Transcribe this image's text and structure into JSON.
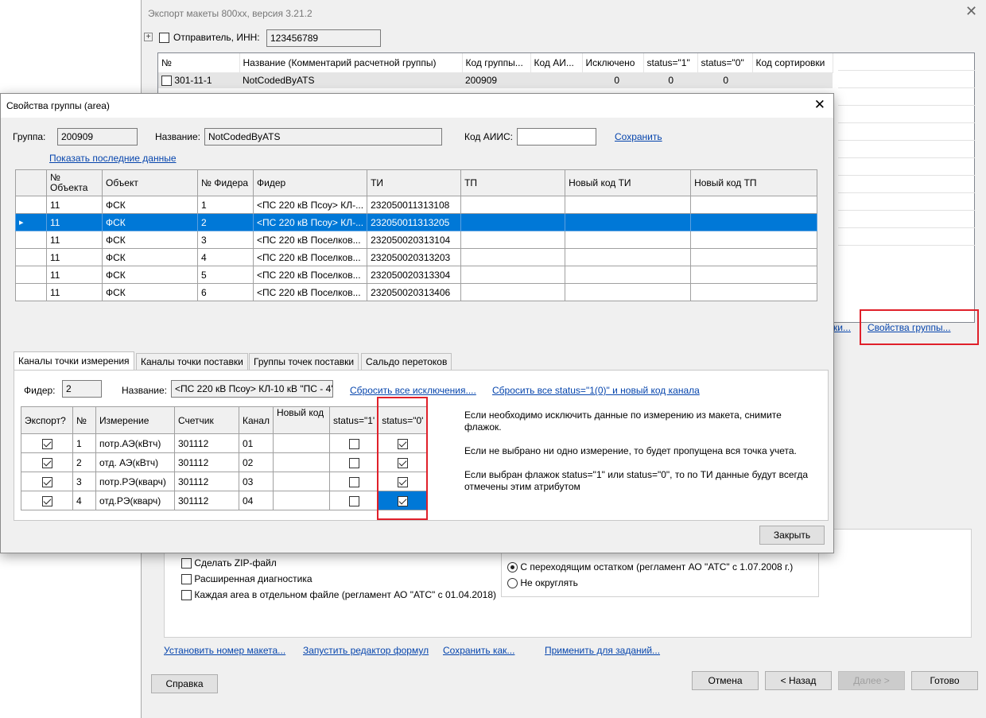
{
  "bg_window": {
    "title": "Экспорт макеты 800хх, версия 3.21.2",
    "sender_label": "Отправитель, ИНН:",
    "sender_inn": "123456789",
    "columns": [
      "№",
      "Название (Комментарий расчетной группы)",
      "Код группы...",
      "Код АИ...",
      "Исключено",
      "status=\"1\"",
      "status=\"0\"",
      "Код сортировки"
    ],
    "rows": [
      {
        "num": "301-11-1",
        "name": "NotCodedByATS",
        "code": "200909",
        "ai": "",
        "excluded": "0",
        "s1": "0",
        "s0": "0",
        "sort": ""
      }
    ],
    "link_partial": "ки...",
    "group_props_link": "Свойства группы...",
    "options": {
      "zip": "Сделать ZIP-файл",
      "diag": "Расширенная диагностика",
      "each_area": "Каждая area в отдельном файле (регламент АО \"АТС\" с 01.04.2018)",
      "radio_carry": "С переходящим остатком (регламент АО \"АТС\" с 1.07.2008 г.)",
      "radio_noround": "Не округлять"
    },
    "bottom_links": [
      "Установить номер макета...",
      "Запустить редактор формул",
      "Сохранить как...",
      "Применить для заданий..."
    ],
    "buttons": {
      "help": "Справка",
      "cancel": "Отмена",
      "back": "< Назад",
      "next": "Далее >",
      "done": "Готово"
    }
  },
  "dialog": {
    "title": "Свойства группы (area)",
    "group_label": "Группа:",
    "group_value": "200909",
    "name_label": "Название:",
    "name_value": "NotCodedByATS",
    "aiis_label": "Код АИИС:",
    "aiis_value": "",
    "save_link": "Сохранить",
    "show_last_link": "Показать последние данные",
    "grid1_columns": [
      "№ Объекта",
      "Объект",
      "№ Фидера",
      "Фидер",
      "ТИ",
      "ТП",
      "Новый код ТИ",
      "Новый код ТП"
    ],
    "grid1_rows": [
      {
        "obj_num": "11",
        "obj": "ФСК",
        "feeder_num": "1",
        "feeder": "<ПС 220 кВ Псоу> КЛ-...",
        "ti": "232050011313108",
        "tp": "",
        "new_ti": "",
        "new_tp": "",
        "selected": false
      },
      {
        "obj_num": "11",
        "obj": "ФСК",
        "feeder_num": "2",
        "feeder": "<ПС 220 кВ Псоу> КЛ-...",
        "ti": "232050011313205",
        "tp": "",
        "new_ti": "",
        "new_tp": "",
        "selected": true
      },
      {
        "obj_num": "11",
        "obj": "ФСК",
        "feeder_num": "3",
        "feeder": "<ПС 220 кВ  Поселков...",
        "ti": "232050020313104",
        "tp": "",
        "new_ti": "",
        "new_tp": "",
        "selected": false
      },
      {
        "obj_num": "11",
        "obj": "ФСК",
        "feeder_num": "4",
        "feeder": "<ПС 220 кВ  Поселков...",
        "ti": "232050020313203",
        "tp": "",
        "new_ti": "",
        "new_tp": "",
        "selected": false
      },
      {
        "obj_num": "11",
        "obj": "ФСК",
        "feeder_num": "5",
        "feeder": "<ПС 220 кВ  Поселков...",
        "ti": "232050020313304",
        "tp": "",
        "new_ti": "",
        "new_tp": "",
        "selected": false
      },
      {
        "obj_num": "11",
        "obj": "ФСК",
        "feeder_num": "6",
        "feeder": "<ПС 220 кВ  Поселков...",
        "ti": "232050020313406",
        "tp": "",
        "new_ti": "",
        "new_tp": "",
        "selected": false
      }
    ],
    "tabs": [
      "Каналы точки измерения",
      "Каналы точки поставки",
      "Группы точек поставки",
      "Сальдо перетоков"
    ],
    "feeder_label": "Фидер:",
    "feeder_value": "2",
    "feeder_name_label": "Название:",
    "feeder_name_value": "<ПС 220 кВ Псоу> КЛ-10 кВ \"ПС - 4'",
    "reset_exclusions_link": "Сбросить все исключения....",
    "reset_status_link": "Сбросить все status=\"1(0)\" и новый код канала",
    "grid2_columns": [
      "Экспорт?",
      "№",
      "Измерение",
      "Счетчик",
      "Канал",
      "Новый код",
      "status=\"1'",
      "status=\"0'"
    ],
    "grid2_rows": [
      {
        "export": true,
        "num": "1",
        "measure": "потр.АЭ(кВтч)",
        "meter": "301112",
        "channel": "01",
        "new_code": "",
        "s1": false,
        "s0": true
      },
      {
        "export": true,
        "num": "2",
        "measure": "отд. АЭ(кВтч)",
        "meter": "301112",
        "channel": "02",
        "new_code": "",
        "s1": false,
        "s0": true
      },
      {
        "export": true,
        "num": "3",
        "measure": "потр.РЭ(кварч)",
        "meter": "301112",
        "channel": "03",
        "new_code": "",
        "s1": false,
        "s0": true
      },
      {
        "export": true,
        "num": "4",
        "measure": "отд.РЭ(кварч)",
        "meter": "301112",
        "channel": "04",
        "new_code": "",
        "s1": false,
        "s0": true
      }
    ],
    "help_text_1": "Если необходимо исключить данные по измерению из макета, снимите флажок.",
    "help_text_2": "Если не выбрано ни одно измерение, то будет пропущена вся точка учета.",
    "help_text_3": "Если выбран флажок status=\"1\" или status=\"0\", то по ТИ данные будут всегда отмечены этим атрибутом",
    "close_button": "Закрыть"
  }
}
